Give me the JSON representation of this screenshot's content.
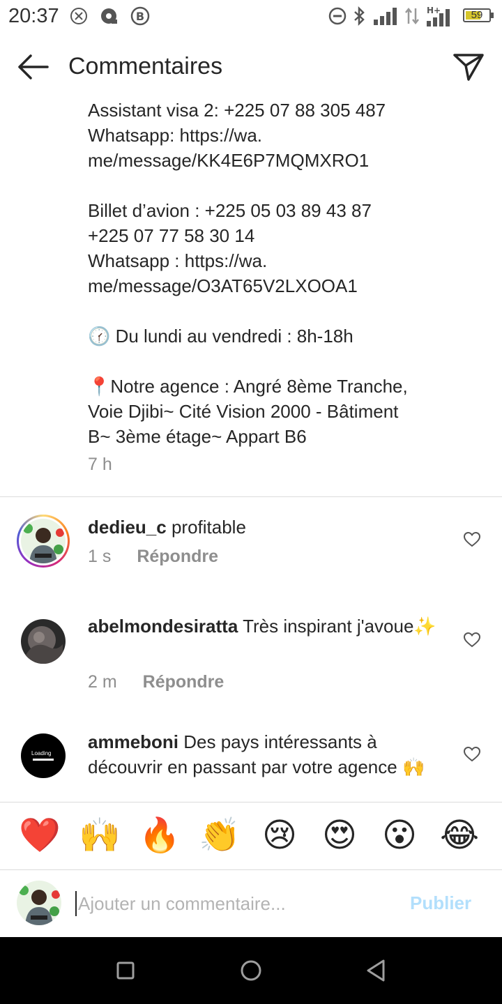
{
  "status_bar": {
    "time": "20:37",
    "battery": "59",
    "icons": [
      "notification-x-icon",
      "record-icon",
      "b-circle-icon",
      "do-not-disturb-icon",
      "bluetooth-icon",
      "signal-icon",
      "data-arrows-icon",
      "hplus-signal-icon",
      "battery-icon"
    ]
  },
  "header": {
    "title": "Commentaires",
    "back_icon": "arrow-left-icon",
    "share_icon": "send-icon"
  },
  "caption": {
    "lines": [
      "Assistant visa 2: +225 07 88 305 487",
      "Whatsapp: https://wa.",
      "me/message/KK4E6P7MQMXRO1",
      "",
      "Billet d’avion : +225 05 03 89 43 87",
      "+225 07 77 58 30 14",
      "Whatsapp : https://wa.",
      "me/message/O3AT65V2LXOOA1",
      "",
      "🕜 Du lundi au vendredi : 8h-18h",
      "",
      "📍Notre agence : Angré 8ème Tranche,",
      "Voie Djibi~ Cité Vision 2000 - Bâtiment",
      "B~ 3ème étage~ Appart B6"
    ],
    "time": "7 h"
  },
  "comments": [
    {
      "username": "dedieu_c",
      "text": "profitable",
      "time": "1 s",
      "reply": "Répondre"
    },
    {
      "username": "abelmondesiratta",
      "text": "Très inspirant j'avoue✨",
      "time": "2 m",
      "reply": "Répondre"
    },
    {
      "username": "ammeboni",
      "text": "Des pays intéressants à découvrir en passant par votre agence 🙌",
      "avatar_text": "Loading"
    }
  ],
  "emoji_bar": [
    "❤️",
    "🙌",
    "🔥",
    "👏",
    "😢",
    "😍",
    "😮",
    "😂"
  ],
  "composer": {
    "placeholder": "Ajouter un commentaire...",
    "publish": "Publier"
  },
  "nav": [
    "recents-square-icon",
    "home-circle-icon",
    "back-triangle-icon"
  ],
  "colors": {
    "text": "#262626",
    "secondary": "#8e8e8e",
    "publish_disabled": "#b2dffc",
    "divider": "#dbdbdb"
  }
}
